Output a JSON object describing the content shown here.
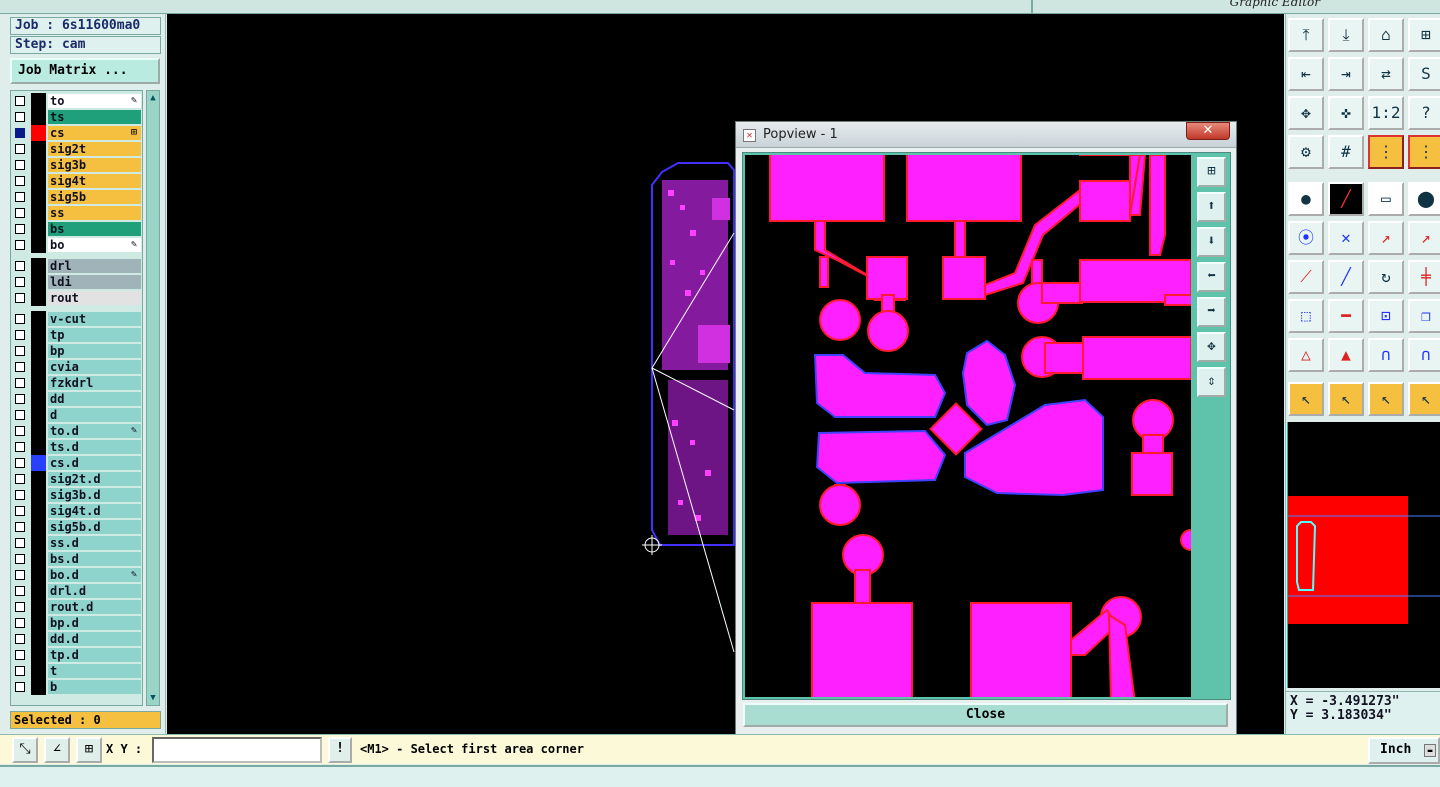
{
  "window": {
    "title_right": "Graphic Editor"
  },
  "job": {
    "job_label": "Job : 6s11600ma0",
    "step_label": "Step: cam",
    "matrix_button": "Job Matrix ..."
  },
  "layers": [
    {
      "name": "to",
      "color": "#ffffff",
      "selected": false,
      "mark": "pen"
    },
    {
      "name": "ts",
      "color": "#1fa07a",
      "selected": false,
      "mark": ""
    },
    {
      "name": "cs",
      "color": "#f5c040",
      "selected": true,
      "mark": "grid",
      "swatch": "#ff0000"
    },
    {
      "name": "sig2t",
      "color": "#f5c040",
      "selected": false,
      "mark": ""
    },
    {
      "name": "sig3b",
      "color": "#f5c040",
      "selected": false,
      "mark": ""
    },
    {
      "name": "sig4t",
      "color": "#f5c040",
      "selected": false,
      "mark": ""
    },
    {
      "name": "sig5b",
      "color": "#f5c040",
      "selected": false,
      "mark": ""
    },
    {
      "name": "ss",
      "color": "#f5c040",
      "selected": false,
      "mark": ""
    },
    {
      "name": "bs",
      "color": "#1fa07a",
      "selected": false,
      "mark": ""
    },
    {
      "name": "bo",
      "color": "#ffffff",
      "selected": false,
      "mark": "pen"
    },
    {
      "name": "drl",
      "color": "#9fb3b8",
      "selected": false,
      "mark": "",
      "gap": true
    },
    {
      "name": "ldi",
      "color": "#9fb3b8",
      "selected": false,
      "mark": ""
    },
    {
      "name": "rout",
      "color": "#e2e2e2",
      "selected": false,
      "mark": ""
    },
    {
      "name": "v-cut",
      "color": "#8fd4cc",
      "selected": false,
      "mark": "",
      "gap": true
    },
    {
      "name": "tp",
      "color": "#8fd4cc",
      "selected": false,
      "mark": ""
    },
    {
      "name": "bp",
      "color": "#8fd4cc",
      "selected": false,
      "mark": ""
    },
    {
      "name": "cvia",
      "color": "#8fd4cc",
      "selected": false,
      "mark": ""
    },
    {
      "name": "fzkdrl",
      "color": "#8fd4cc",
      "selected": false,
      "mark": ""
    },
    {
      "name": "dd",
      "color": "#8fd4cc",
      "selected": false,
      "mark": ""
    },
    {
      "name": "d",
      "color": "#8fd4cc",
      "selected": false,
      "mark": ""
    },
    {
      "name": "to.d",
      "color": "#8fd4cc",
      "selected": false,
      "mark": "pen"
    },
    {
      "name": "ts.d",
      "color": "#8fd4cc",
      "selected": false,
      "mark": ""
    },
    {
      "name": "cs.d",
      "color": "#8fd4cc",
      "selected": false,
      "mark": "",
      "swatch": "#2a40ff"
    },
    {
      "name": "sig2t.d",
      "color": "#8fd4cc",
      "selected": false,
      "mark": ""
    },
    {
      "name": "sig3b.d",
      "color": "#8fd4cc",
      "selected": false,
      "mark": ""
    },
    {
      "name": "sig4t.d",
      "color": "#8fd4cc",
      "selected": false,
      "mark": ""
    },
    {
      "name": "sig5b.d",
      "color": "#8fd4cc",
      "selected": false,
      "mark": ""
    },
    {
      "name": "ss.d",
      "color": "#8fd4cc",
      "selected": false,
      "mark": ""
    },
    {
      "name": "bs.d",
      "color": "#8fd4cc",
      "selected": false,
      "mark": ""
    },
    {
      "name": "bo.d",
      "color": "#8fd4cc",
      "selected": false,
      "mark": "pen"
    },
    {
      "name": "drl.d",
      "color": "#8fd4cc",
      "selected": false,
      "mark": ""
    },
    {
      "name": "rout.d",
      "color": "#8fd4cc",
      "selected": false,
      "mark": ""
    },
    {
      "name": "bp.d",
      "color": "#8fd4cc",
      "selected": false,
      "mark": ""
    },
    {
      "name": "dd.d",
      "color": "#8fd4cc",
      "selected": false,
      "mark": ""
    },
    {
      "name": "tp.d",
      "color": "#8fd4cc",
      "selected": false,
      "mark": ""
    },
    {
      "name": "t",
      "color": "#8fd4cc",
      "selected": false,
      "mark": ""
    },
    {
      "name": "b",
      "color": "#8fd4cc",
      "selected": false,
      "mark": ""
    }
  ],
  "selection": {
    "label": "Selected : 0"
  },
  "popview": {
    "title": "Popview - 1",
    "close_x": "✕",
    "close_button": "Close"
  },
  "coords": {
    "x": "X = -3.491273\"",
    "y": "Y = 3.183034\""
  },
  "bottom": {
    "xy_label": "X Y :",
    "xy_value": "",
    "warn": "!",
    "message": "<M1> - Select first area corner",
    "units": "Inch"
  },
  "colors": {
    "pad_fill": "#ff20ff",
    "pad_edge": "#ff1a30",
    "accent": "#5fc2aa",
    "highlight": "#f5c040"
  }
}
